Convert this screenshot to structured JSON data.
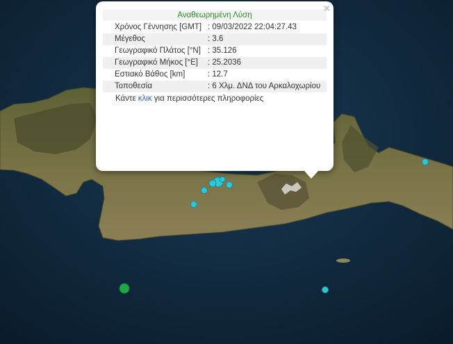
{
  "popup": {
    "title": "Αναθεωρημένη Λύση",
    "close_symbol": "×",
    "rows": [
      {
        "label": "Χρόνος Γέννησης [GMT]",
        "value": ": 09/03/2022 22:04:27.43"
      },
      {
        "label": "Μέγεθος",
        "value": ": 3.6"
      },
      {
        "label": "Γεωγραφικό Πλάτος [°N]",
        "value": ": 35.126"
      },
      {
        "label": "Γεωγραφικό Μήκος [°E]",
        "value": ": 25.2036"
      },
      {
        "label": "Εστιακό Βάθος [km]",
        "value": ": 12.7"
      },
      {
        "label": "Τοποθεσία",
        "value": ": 6 Χλμ. ΔΝΔ του Αρκαλοχωρίου"
      }
    ],
    "more_prefix": "Κάντε ",
    "more_link": "κλικ",
    "more_suffix": " για περισσότερες πληροφορίες"
  },
  "colors": {
    "sea": "#0e2538",
    "land": "#6f6a3e",
    "marker_cyan": "#2fc6d6",
    "marker_green": "#1fa64a",
    "title_green": "#2a8a2a",
    "link_blue": "#2a62c9"
  },
  "icons": {
    "close": "close-icon",
    "quake_marker": "earthquake-marker-icon"
  }
}
